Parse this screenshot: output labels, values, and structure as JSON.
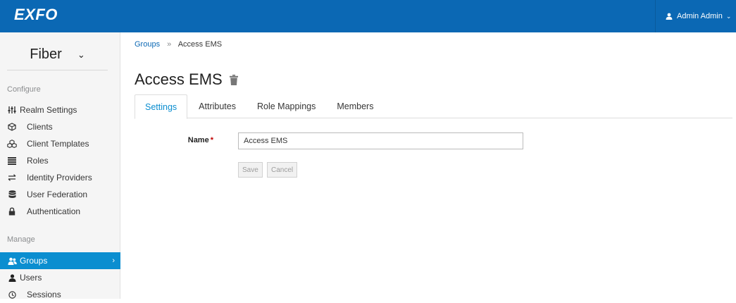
{
  "header": {
    "brand": "EXFO",
    "user": "Admin Admin",
    "user_icon": "user-icon",
    "caret_icon": "chevron-down-icon"
  },
  "sidebar": {
    "realm": "Fiber",
    "configure_label": "Configure",
    "configure_items": [
      {
        "label": "Realm Settings",
        "icon": "sliders-icon"
      },
      {
        "label": "Clients",
        "icon": "cube-icon"
      },
      {
        "label": "Client Templates",
        "icon": "cubes-icon"
      },
      {
        "label": "Roles",
        "icon": "list-icon"
      },
      {
        "label": "Identity Providers",
        "icon": "exchange-icon"
      },
      {
        "label": "User Federation",
        "icon": "database-icon"
      },
      {
        "label": "Authentication",
        "icon": "lock-icon"
      }
    ],
    "manage_label": "Manage",
    "manage_items": [
      {
        "label": "Groups",
        "icon": "users-icon",
        "active": true
      },
      {
        "label": "Users",
        "icon": "user-icon"
      },
      {
        "label": "Sessions",
        "icon": "clock-icon"
      }
    ],
    "active_arrow": "›"
  },
  "breadcrumb": {
    "parent": "Groups",
    "separator": "»",
    "current": "Access EMS"
  },
  "page": {
    "title": "Access EMS",
    "delete_icon": "trash-icon"
  },
  "tabs": [
    "Settings",
    "Attributes",
    "Role Mappings",
    "Members"
  ],
  "active_tab": "Settings",
  "form": {
    "name_label": "Name",
    "required_mark": "*",
    "name_value": "Access EMS",
    "save_label": "Save",
    "cancel_label": "Cancel"
  },
  "colors": {
    "header_bg": "#0b68b4",
    "active_nav_bg": "#0b8ed0",
    "active_tab_text": "#0b8ed0"
  }
}
